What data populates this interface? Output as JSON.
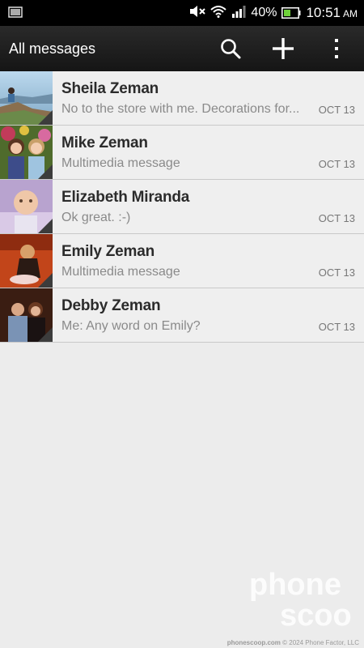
{
  "status_bar": {
    "battery_percent": "40%",
    "time": "10:51",
    "ampm": "AM",
    "icons": [
      "screenshot-icon",
      "mute-icon",
      "wifi-icon",
      "signal-icon",
      "battery-icon"
    ]
  },
  "header": {
    "title": "All messages",
    "actions": [
      "search-icon",
      "add-icon",
      "overflow-menu-icon"
    ]
  },
  "conversations": [
    {
      "name": "Sheila Zeman",
      "preview": "No to the store with me. Decorations for...",
      "date": "OCT 13"
    },
    {
      "name": "Mike Zeman",
      "preview": "Multimedia message",
      "date": "OCT 13"
    },
    {
      "name": "Elizabeth Miranda",
      "preview": "Ok great. :-)",
      "date": "OCT 13"
    },
    {
      "name": "Emily Zeman",
      "preview": "Multimedia message",
      "date": "OCT 13"
    },
    {
      "name": "Debby Zeman",
      "preview": "Me: Any word on Emily?",
      "date": "OCT 13"
    }
  ],
  "watermark": {
    "line1": "phone",
    "line2": "scoop"
  },
  "footer": {
    "site": "phonescoop.com",
    "copyright": "© 2024 Phone Factor, LLC"
  }
}
